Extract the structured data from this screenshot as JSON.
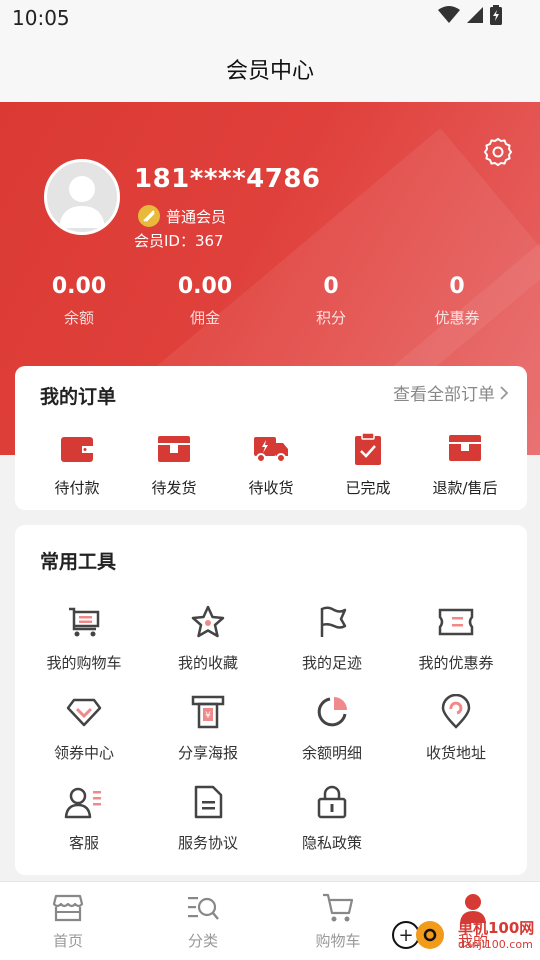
{
  "status_bar": {
    "time": "10:05",
    "icons": [
      "wifi-icon",
      "signal-icon",
      "battery-icon"
    ]
  },
  "header": {
    "title": "会员中心"
  },
  "profile": {
    "phone": "181****4786",
    "level": "普通会员",
    "member_id": "会员ID：367"
  },
  "stats": [
    {
      "value": "0.00",
      "label": "余额"
    },
    {
      "value": "0.00",
      "label": "佣金"
    },
    {
      "value": "0",
      "label": "积分"
    },
    {
      "value": "0",
      "label": "优惠券"
    }
  ],
  "orders": {
    "title": "我的订单",
    "view_all": "查看全部订单",
    "items": [
      {
        "label": "待付款",
        "icon": "wallet-icon"
      },
      {
        "label": "待发货",
        "icon": "package-icon"
      },
      {
        "label": "待收货",
        "icon": "truck-icon"
      },
      {
        "label": "已完成",
        "icon": "clipboard-check-icon"
      },
      {
        "label": "退款/售后",
        "icon": "refund-box-icon"
      }
    ]
  },
  "tools": {
    "title": "常用工具",
    "items": [
      {
        "label": "我的购物车",
        "icon": "cart-icon"
      },
      {
        "label": "我的收藏",
        "icon": "star-icon"
      },
      {
        "label": "我的足迹",
        "icon": "flag-icon"
      },
      {
        "label": "我的优惠券",
        "icon": "ticket-icon"
      },
      {
        "label": "领券中心",
        "icon": "diamond-icon"
      },
      {
        "label": "分享海报",
        "icon": "poster-icon"
      },
      {
        "label": "余额明细",
        "icon": "pie-chart-icon"
      },
      {
        "label": "收货地址",
        "icon": "location-pin-icon"
      },
      {
        "label": "客服",
        "icon": "customer-service-icon"
      },
      {
        "label": "服务协议",
        "icon": "document-icon"
      },
      {
        "label": "隐私政策",
        "icon": "lock-icon"
      }
    ]
  },
  "bottom_nav": [
    {
      "label": "首页",
      "icon": "shop-icon",
      "active": false
    },
    {
      "label": "分类",
      "icon": "category-search-icon",
      "active": false
    },
    {
      "label": "购物车",
      "icon": "cart-icon",
      "active": false
    },
    {
      "label": "我的",
      "icon": "user-icon",
      "active": true
    }
  ],
  "watermark": {
    "text": "单机100网",
    "sub": "danji100.com"
  },
  "colors": {
    "brand_red": "#d63a34",
    "accent_pink": "#f08a8a",
    "gold": "#e8b93b"
  }
}
